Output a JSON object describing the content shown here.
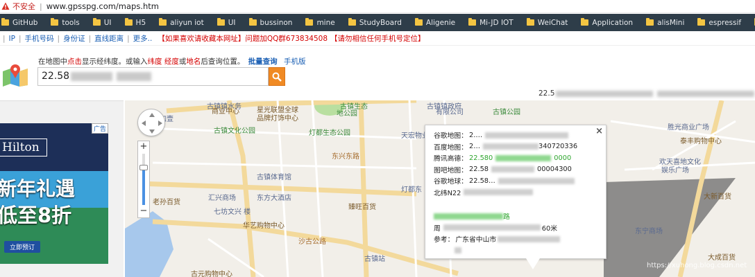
{
  "address_bar": {
    "insecure": "不安全",
    "url": "www.gpsspg.com/maps.htm"
  },
  "bookmarks": [
    {
      "label": "GitHub",
      "icon": "folder-icon"
    },
    {
      "label": "tools",
      "icon": "folder-icon"
    },
    {
      "label": "UI",
      "icon": "folder-icon"
    },
    {
      "label": "H5",
      "icon": "folder-icon"
    },
    {
      "label": "aliyun iot",
      "icon": "folder-icon"
    },
    {
      "label": "UI",
      "icon": "folder-icon"
    },
    {
      "label": "bussinon",
      "icon": "folder-icon"
    },
    {
      "label": "mine",
      "icon": "folder-icon"
    },
    {
      "label": "StudyBoard",
      "icon": "folder-icon"
    },
    {
      "label": "Aligenie",
      "icon": "folder-icon"
    },
    {
      "label": "Mi-JD IOT",
      "icon": "folder-icon"
    },
    {
      "label": "WeiChat",
      "icon": "folder-icon"
    },
    {
      "label": "Application",
      "icon": "folder-icon"
    },
    {
      "label": "alisMini",
      "icon": "folder-icon"
    },
    {
      "label": "espressif",
      "icon": "folder-icon"
    },
    {
      "label": "BleMesh",
      "icon": "folder-icon"
    },
    {
      "label": "xuhongv",
      "icon": "github-icon"
    },
    {
      "label": "csdn",
      "icon": "csdn-icon"
    }
  ],
  "nav": {
    "ip": "IP",
    "phone": "手机号码",
    "idcard": "身份证",
    "distance": "直线距离",
    "more": "更多..",
    "notice1": "【如果喜欢请收藏本网址】问题加QQ群673834508",
    "notice2": "【请勿相信任何手机号定位】"
  },
  "search": {
    "hint_pre": "在地图中",
    "hint_click": "点击",
    "hint_mid1": "显示经纬度。或输入",
    "hint_lat": "纬度",
    "hint_lng": "经度",
    "hint_or": "或",
    "hint_place": "地名",
    "hint_post": "后查询位置。",
    "batch": "批量查询",
    "mobile": "手机版",
    "value": "22.58",
    "coord_strip_start": "22.5",
    "coord_strip_end": "05"
  },
  "ad": {
    "tag": "广告",
    "brand": "Hilton",
    "line1": "新年礼遇",
    "line2": "低至8折",
    "button": "立即预订"
  },
  "map_labels": [
    {
      "text": "壹加壹",
      "cls": "b"
    },
    {
      "text": "古镇镇水务",
      "cls": "b"
    },
    {
      "text": "商业中心",
      "cls": ""
    },
    {
      "text": "古镇生态",
      "cls": "g"
    },
    {
      "text": "地公园",
      "cls": "g"
    },
    {
      "text": "古镇镇政府",
      "cls": "b"
    },
    {
      "text": "有限公司",
      "cls": "b"
    },
    {
      "text": "古镇公园",
      "cls": "g"
    },
    {
      "text": "星光联盟全球",
      "cls": ""
    },
    {
      "text": "品牌灯饰中心",
      "cls": ""
    },
    {
      "text": "古镇文化公园",
      "cls": "g"
    },
    {
      "text": "灯都生态公园",
      "cls": "g"
    },
    {
      "text": "天宏物业",
      "cls": "b"
    },
    {
      "text": "东兴东路",
      "cls": "road"
    },
    {
      "text": "古镇体育馆",
      "cls": "b"
    },
    {
      "text": "汇兴商场",
      "cls": "b"
    },
    {
      "text": "东方大酒店",
      "cls": "b"
    },
    {
      "text": "老孙百货",
      "cls": ""
    },
    {
      "text": "七坊文兴 楼",
      "cls": "b"
    },
    {
      "text": "华艺购物中心",
      "cls": ""
    },
    {
      "text": "臻旺百货",
      "cls": ""
    },
    {
      "text": "灯都东",
      "cls": "b"
    },
    {
      "text": "沙古公路",
      "cls": "road"
    },
    {
      "text": "古镇站",
      "cls": "b"
    },
    {
      "text": "古元购物中心",
      "cls": ""
    },
    {
      "text": "胜光商业广场",
      "cls": "b"
    },
    {
      "text": "泰丰购物中心",
      "cls": ""
    },
    {
      "text": "欢天喜地文化",
      "cls": "b"
    },
    {
      "text": "娱乐广场",
      "cls": "b"
    },
    {
      "text": "大新百货",
      "cls": ""
    },
    {
      "text": "大成百货",
      "cls": ""
    },
    {
      "text": "东宁商场",
      "cls": "b"
    }
  ],
  "popup": {
    "rows": [
      {
        "k": "谷歌地图：",
        "v": "2.…",
        "tail": ""
      },
      {
        "k": "百度地图：",
        "v": "2…",
        "tail": "340720336"
      },
      {
        "k": "腾讯高德：",
        "v": "22.580",
        "tail": "0000"
      },
      {
        "k": "图吧地图：",
        "v": "22.58",
        "tail": "00004300"
      },
      {
        "k": "谷歌地球：",
        "v": "22.58…",
        "tail": ""
      },
      {
        "k": "北纬N22",
        "v": "",
        "tail": ""
      }
    ],
    "link_tail": "路",
    "near_prefix": "周",
    "near_tail": "60米",
    "ref_label": "参考：",
    "ref_value": "广东省中山市",
    "ref_more": "街道"
  },
  "watermark": "https://xuhong.blog.csdn.net"
}
